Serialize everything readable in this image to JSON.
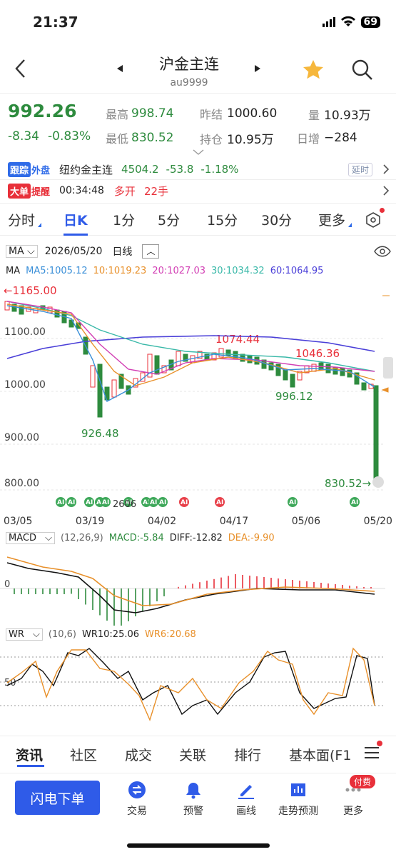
{
  "status": {
    "time": "21:37",
    "battery": "69"
  },
  "header": {
    "title": "沪金主连",
    "code": "au9999"
  },
  "quote": {
    "price": "992.26",
    "change": "-8.34",
    "change_pct": "-0.83%",
    "high_label": "最高",
    "high": "998.74",
    "low_label": "最低",
    "low": "830.52",
    "prev_settle_label": "昨结",
    "prev_settle": "1000.60",
    "open_int_label": "持仓",
    "open_int": "10.95万",
    "volume_label": "量",
    "volume": "10.93万",
    "daily_inc_label": "日增",
    "daily_inc": "−284"
  },
  "track": {
    "badge1": "跟踪",
    "badge2": "外盘",
    "name": "纽约金主连",
    "price": "4504.2",
    "change": "-53.8",
    "pct": "-1.18%",
    "delay": "延时"
  },
  "alert": {
    "badge1": "大单",
    "badge2": "提醒",
    "time": "00:34:48",
    "type": "多开",
    "qty": "22手"
  },
  "tabs": [
    "分时",
    "日K",
    "1分",
    "5分",
    "15分",
    "30分",
    "更多"
  ],
  "chart": {
    "indicator": "MA",
    "date": "2026/05/20",
    "period": "日线",
    "ma_label": "MA",
    "ma5": "MA5:1005.12",
    "ma10": "10:1019.23",
    "ma20": "20:1027.03",
    "ma30": "30:1034.32",
    "ma60": "60:1064.95",
    "y_labels": [
      "1100.00",
      "1000.00",
      "900.00",
      "800.00"
    ],
    "max_label": "←1165.00",
    "hi_label": "1074.44",
    "hi2_label": "1046.36",
    "lo_label": "926.48",
    "lo2_label": "996.12",
    "last_label": "830.52→",
    "mid_date": "2606",
    "x_labels": [
      "03/05",
      "03/19",
      "04/02",
      "04/17",
      "05/06",
      "05/20"
    ],
    "ai": "AI"
  },
  "macd": {
    "name": "MACD",
    "params": "(12,26,9)",
    "macd": "MACD:-5.84",
    "diff": "DIFF:-12.82",
    "dea": "DEA:-9.90",
    "zero": "0"
  },
  "wr": {
    "name": "WR",
    "params": "(10,6)",
    "wr10": "WR10:25.06",
    "wr6": "WR6:20.68",
    "fifty": "50"
  },
  "bottom_tabs": [
    "资讯",
    "社区",
    "成交",
    "关联",
    "排行",
    "基本面(F1"
  ],
  "nav": {
    "flash": "闪电下单",
    "items": [
      "交易",
      "预警",
      "画线",
      "走势预测",
      "更多"
    ],
    "pay": "付费"
  },
  "colors": {
    "up": "#e8303a",
    "down": "#2e8b3e",
    "accent": "#2f5be8",
    "ma5": "#3a8fd8",
    "ma10": "#e8902a",
    "ma20": "#d23fb4",
    "ma30": "#38b8a8",
    "ma60": "#4a3fd8"
  }
}
